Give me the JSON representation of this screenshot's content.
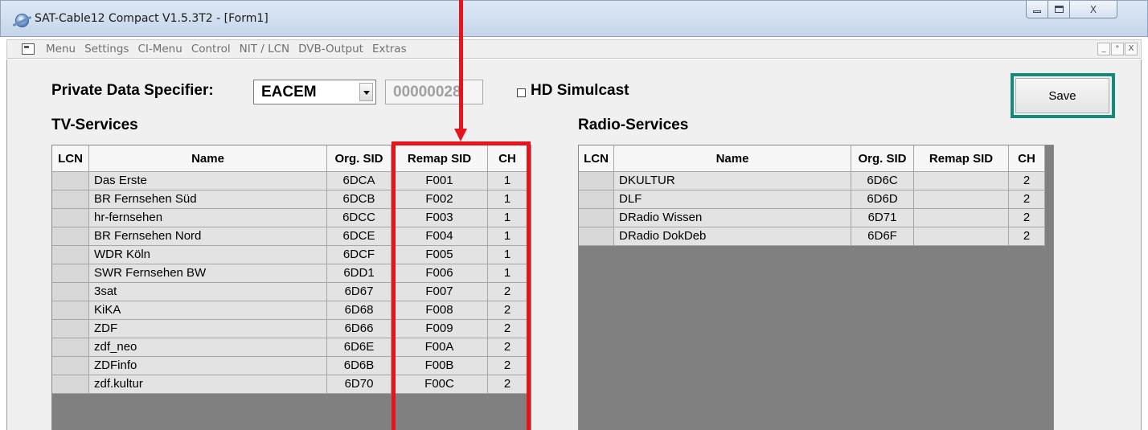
{
  "window": {
    "title": "SAT-Cable12 Compact V1.5.3T2 - [Form1]",
    "min_glyph": "—",
    "max_glyph": "□",
    "close_glyph": "X"
  },
  "menu": {
    "items": [
      "Menu",
      "Settings",
      "CI-Menu",
      "Control",
      "NIT / LCN",
      "DVB-Output",
      "Extras"
    ],
    "mdi_buttons": [
      "_",
      "ᵊ",
      "X"
    ]
  },
  "form": {
    "pds_label": "Private Data Specifier:",
    "pds_selected": "EACEM",
    "pds_value": "00000028",
    "hd_simulcast_label": "HD Simulcast",
    "hd_simulcast_checked": false,
    "save_label": "Save"
  },
  "tv": {
    "title": "TV-Services",
    "headers": [
      "LCN",
      "Name",
      "Org. SID",
      "Remap SID",
      "CH"
    ],
    "rows": [
      [
        "",
        "Das Erste",
        "6DCA",
        "F001",
        "1"
      ],
      [
        "",
        "BR Fernsehen Süd",
        "6DCB",
        "F002",
        "1"
      ],
      [
        "",
        "hr-fernsehen",
        "6DCC",
        "F003",
        "1"
      ],
      [
        "",
        "BR Fernsehen Nord",
        "6DCE",
        "F004",
        "1"
      ],
      [
        "",
        "WDR Köln",
        "6DCF",
        "F005",
        "1"
      ],
      [
        "",
        "SWR Fernsehen BW",
        "6DD1",
        "F006",
        "1"
      ],
      [
        "",
        "3sat",
        "6D67",
        "F007",
        "2"
      ],
      [
        "",
        "KiKA",
        "6D68",
        "F008",
        "2"
      ],
      [
        "",
        "ZDF",
        "6D66",
        "F009",
        "2"
      ],
      [
        "",
        "zdf_neo",
        "6D6E",
        "F00A",
        "2"
      ],
      [
        "",
        "ZDFinfo",
        "6D6B",
        "F00B",
        "2"
      ],
      [
        "",
        "zdf.kultur",
        "6D70",
        "F00C",
        "2"
      ]
    ]
  },
  "radio": {
    "title": "Radio-Services",
    "headers": [
      "LCN",
      "Name",
      "Org. SID",
      "Remap SID",
      "CH"
    ],
    "rows": [
      [
        "",
        "DKULTUR",
        "6D6C",
        "",
        "2"
      ],
      [
        "",
        "DLF",
        "6D6D",
        "",
        "2"
      ],
      [
        "",
        "DRadio Wissen",
        "6D71",
        "",
        "2"
      ],
      [
        "",
        "DRadio DokDeb",
        "6D6F",
        "",
        "2"
      ]
    ]
  },
  "colors": {
    "annotation_red": "#e8141b",
    "save_highlight": "#138a7a",
    "grid_empty": "#808080"
  }
}
